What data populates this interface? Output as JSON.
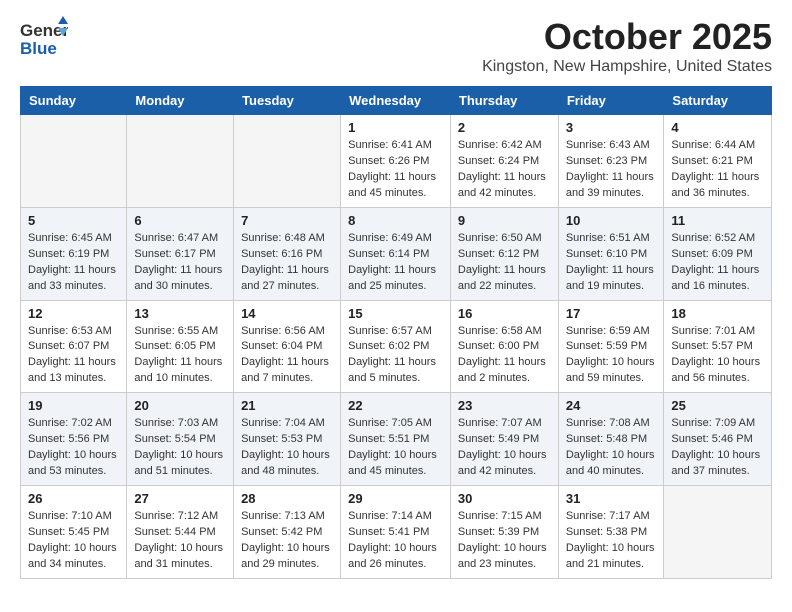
{
  "logo": {
    "general": "General",
    "blue": "Blue"
  },
  "title": "October 2025",
  "location": "Kingston, New Hampshire, United States",
  "days_of_week": [
    "Sunday",
    "Monday",
    "Tuesday",
    "Wednesday",
    "Thursday",
    "Friday",
    "Saturday"
  ],
  "weeks": [
    [
      {
        "day": "",
        "info": ""
      },
      {
        "day": "",
        "info": ""
      },
      {
        "day": "",
        "info": ""
      },
      {
        "day": "1",
        "info": "Sunrise: 6:41 AM\nSunset: 6:26 PM\nDaylight: 11 hours and 45 minutes."
      },
      {
        "day": "2",
        "info": "Sunrise: 6:42 AM\nSunset: 6:24 PM\nDaylight: 11 hours and 42 minutes."
      },
      {
        "day": "3",
        "info": "Sunrise: 6:43 AM\nSunset: 6:23 PM\nDaylight: 11 hours and 39 minutes."
      },
      {
        "day": "4",
        "info": "Sunrise: 6:44 AM\nSunset: 6:21 PM\nDaylight: 11 hours and 36 minutes."
      }
    ],
    [
      {
        "day": "5",
        "info": "Sunrise: 6:45 AM\nSunset: 6:19 PM\nDaylight: 11 hours and 33 minutes."
      },
      {
        "day": "6",
        "info": "Sunrise: 6:47 AM\nSunset: 6:17 PM\nDaylight: 11 hours and 30 minutes."
      },
      {
        "day": "7",
        "info": "Sunrise: 6:48 AM\nSunset: 6:16 PM\nDaylight: 11 hours and 27 minutes."
      },
      {
        "day": "8",
        "info": "Sunrise: 6:49 AM\nSunset: 6:14 PM\nDaylight: 11 hours and 25 minutes."
      },
      {
        "day": "9",
        "info": "Sunrise: 6:50 AM\nSunset: 6:12 PM\nDaylight: 11 hours and 22 minutes."
      },
      {
        "day": "10",
        "info": "Sunrise: 6:51 AM\nSunset: 6:10 PM\nDaylight: 11 hours and 19 minutes."
      },
      {
        "day": "11",
        "info": "Sunrise: 6:52 AM\nSunset: 6:09 PM\nDaylight: 11 hours and 16 minutes."
      }
    ],
    [
      {
        "day": "12",
        "info": "Sunrise: 6:53 AM\nSunset: 6:07 PM\nDaylight: 11 hours and 13 minutes."
      },
      {
        "day": "13",
        "info": "Sunrise: 6:55 AM\nSunset: 6:05 PM\nDaylight: 11 hours and 10 minutes."
      },
      {
        "day": "14",
        "info": "Sunrise: 6:56 AM\nSunset: 6:04 PM\nDaylight: 11 hours and 7 minutes."
      },
      {
        "day": "15",
        "info": "Sunrise: 6:57 AM\nSunset: 6:02 PM\nDaylight: 11 hours and 5 minutes."
      },
      {
        "day": "16",
        "info": "Sunrise: 6:58 AM\nSunset: 6:00 PM\nDaylight: 11 hours and 2 minutes."
      },
      {
        "day": "17",
        "info": "Sunrise: 6:59 AM\nSunset: 5:59 PM\nDaylight: 10 hours and 59 minutes."
      },
      {
        "day": "18",
        "info": "Sunrise: 7:01 AM\nSunset: 5:57 PM\nDaylight: 10 hours and 56 minutes."
      }
    ],
    [
      {
        "day": "19",
        "info": "Sunrise: 7:02 AM\nSunset: 5:56 PM\nDaylight: 10 hours and 53 minutes."
      },
      {
        "day": "20",
        "info": "Sunrise: 7:03 AM\nSunset: 5:54 PM\nDaylight: 10 hours and 51 minutes."
      },
      {
        "day": "21",
        "info": "Sunrise: 7:04 AM\nSunset: 5:53 PM\nDaylight: 10 hours and 48 minutes."
      },
      {
        "day": "22",
        "info": "Sunrise: 7:05 AM\nSunset: 5:51 PM\nDaylight: 10 hours and 45 minutes."
      },
      {
        "day": "23",
        "info": "Sunrise: 7:07 AM\nSunset: 5:49 PM\nDaylight: 10 hours and 42 minutes."
      },
      {
        "day": "24",
        "info": "Sunrise: 7:08 AM\nSunset: 5:48 PM\nDaylight: 10 hours and 40 minutes."
      },
      {
        "day": "25",
        "info": "Sunrise: 7:09 AM\nSunset: 5:46 PM\nDaylight: 10 hours and 37 minutes."
      }
    ],
    [
      {
        "day": "26",
        "info": "Sunrise: 7:10 AM\nSunset: 5:45 PM\nDaylight: 10 hours and 34 minutes."
      },
      {
        "day": "27",
        "info": "Sunrise: 7:12 AM\nSunset: 5:44 PM\nDaylight: 10 hours and 31 minutes."
      },
      {
        "day": "28",
        "info": "Sunrise: 7:13 AM\nSunset: 5:42 PM\nDaylight: 10 hours and 29 minutes."
      },
      {
        "day": "29",
        "info": "Sunrise: 7:14 AM\nSunset: 5:41 PM\nDaylight: 10 hours and 26 minutes."
      },
      {
        "day": "30",
        "info": "Sunrise: 7:15 AM\nSunset: 5:39 PM\nDaylight: 10 hours and 23 minutes."
      },
      {
        "day": "31",
        "info": "Sunrise: 7:17 AM\nSunset: 5:38 PM\nDaylight: 10 hours and 21 minutes."
      },
      {
        "day": "",
        "info": ""
      }
    ]
  ]
}
